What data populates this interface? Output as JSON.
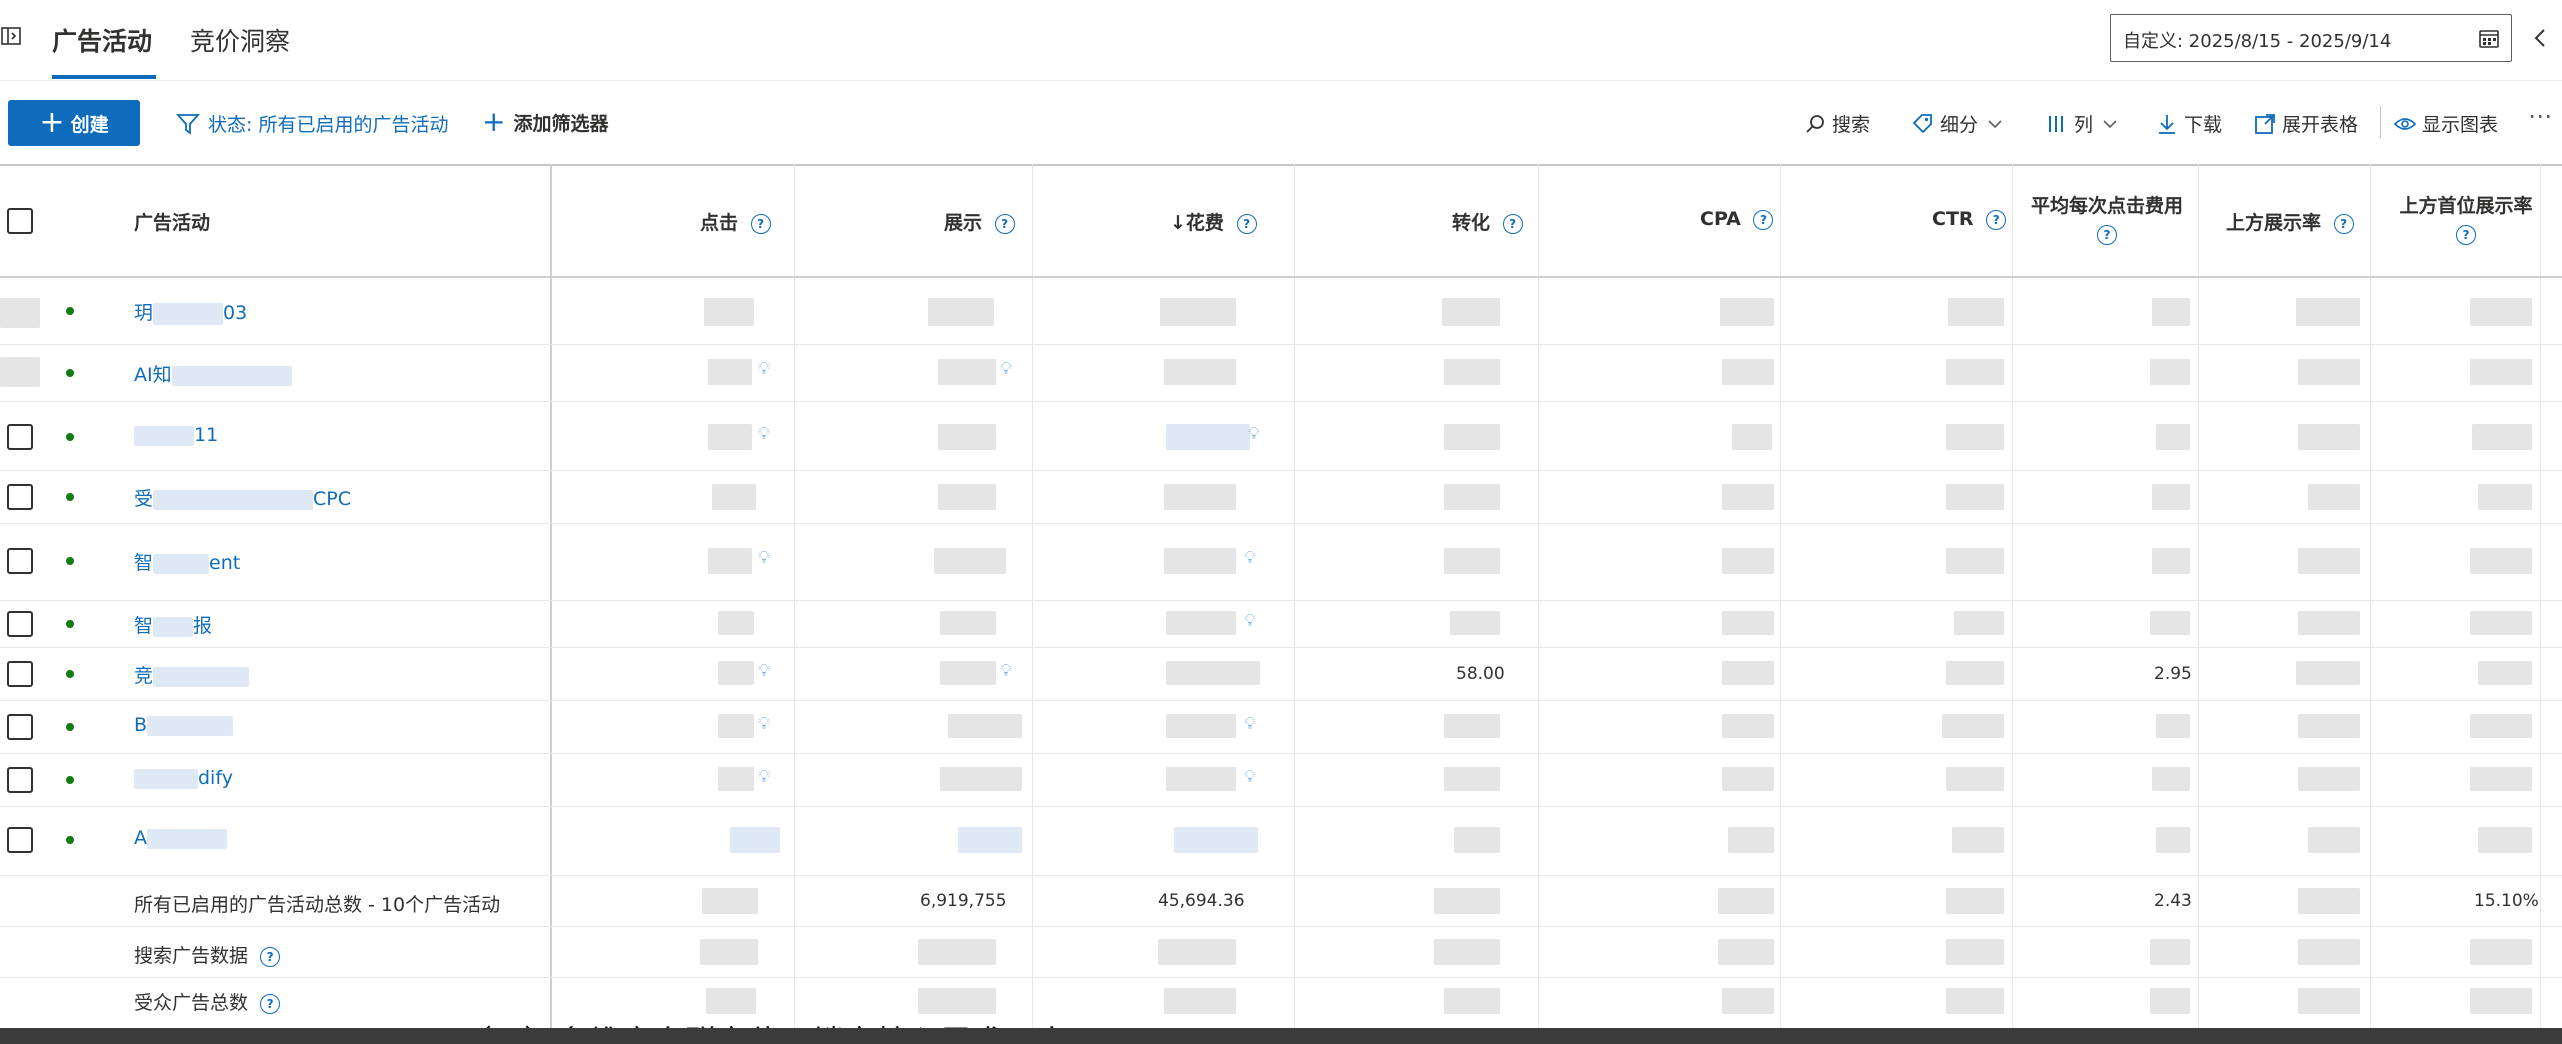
{
  "tabs": [
    {
      "label": "广告活动"
    },
    {
      "label": "竞价洞察"
    }
  ],
  "date_range": "自定义: 2025/8/15 - 2025/9/14",
  "toolbar": {
    "create_label": "创建",
    "status_filter": "状态: 所有已启用的广告活动",
    "add_filter": "添加筛选器",
    "search": "搜索",
    "breakdown": "细分",
    "columns": "列",
    "download": "下载",
    "expand_table": "展开表格",
    "show_chart": "显示图表"
  },
  "table": {
    "headers": [
      "广告活动",
      "点击",
      "展示",
      "↓花费",
      "转化",
      "CPA",
      "CTR",
      "平均每次点击费用",
      "上方展示率",
      "上方首位展示率"
    ],
    "rows": [
      {
        "name": "玥",
        "name_suffix": "03"
      },
      {
        "name": "AI知",
        "name_suffix": ""
      },
      {
        "name": "",
        "name_suffix": "11"
      },
      {
        "name": "受",
        "name_suffix": "CPC"
      },
      {
        "name": "智",
        "name_suffix": "ent"
      },
      {
        "name": "智",
        "name_suffix": "报"
      },
      {
        "name": "竞",
        "name_suffix": "",
        "conversions": "58.00",
        "avg_cpc": "2.95"
      },
      {
        "name": "B",
        "name_suffix": ""
      },
      {
        "name": "",
        "name_suffix": "dify"
      },
      {
        "name": "A",
        "name_suffix": ""
      }
    ],
    "summary": [
      {
        "label": "所有已启用的广告活动总数 - 10个广告活动",
        "impressions": "6,919,755",
        "spend": "45,694.36",
        "avg_cpc": "2.43",
        "top_first_rate": "15.10%"
      },
      {
        "label": "搜索广告数据"
      },
      {
        "label": "受众广告总数"
      }
    ]
  },
  "bottom_text": "（二）多维度人群定位：锁定核心需求用户"
}
